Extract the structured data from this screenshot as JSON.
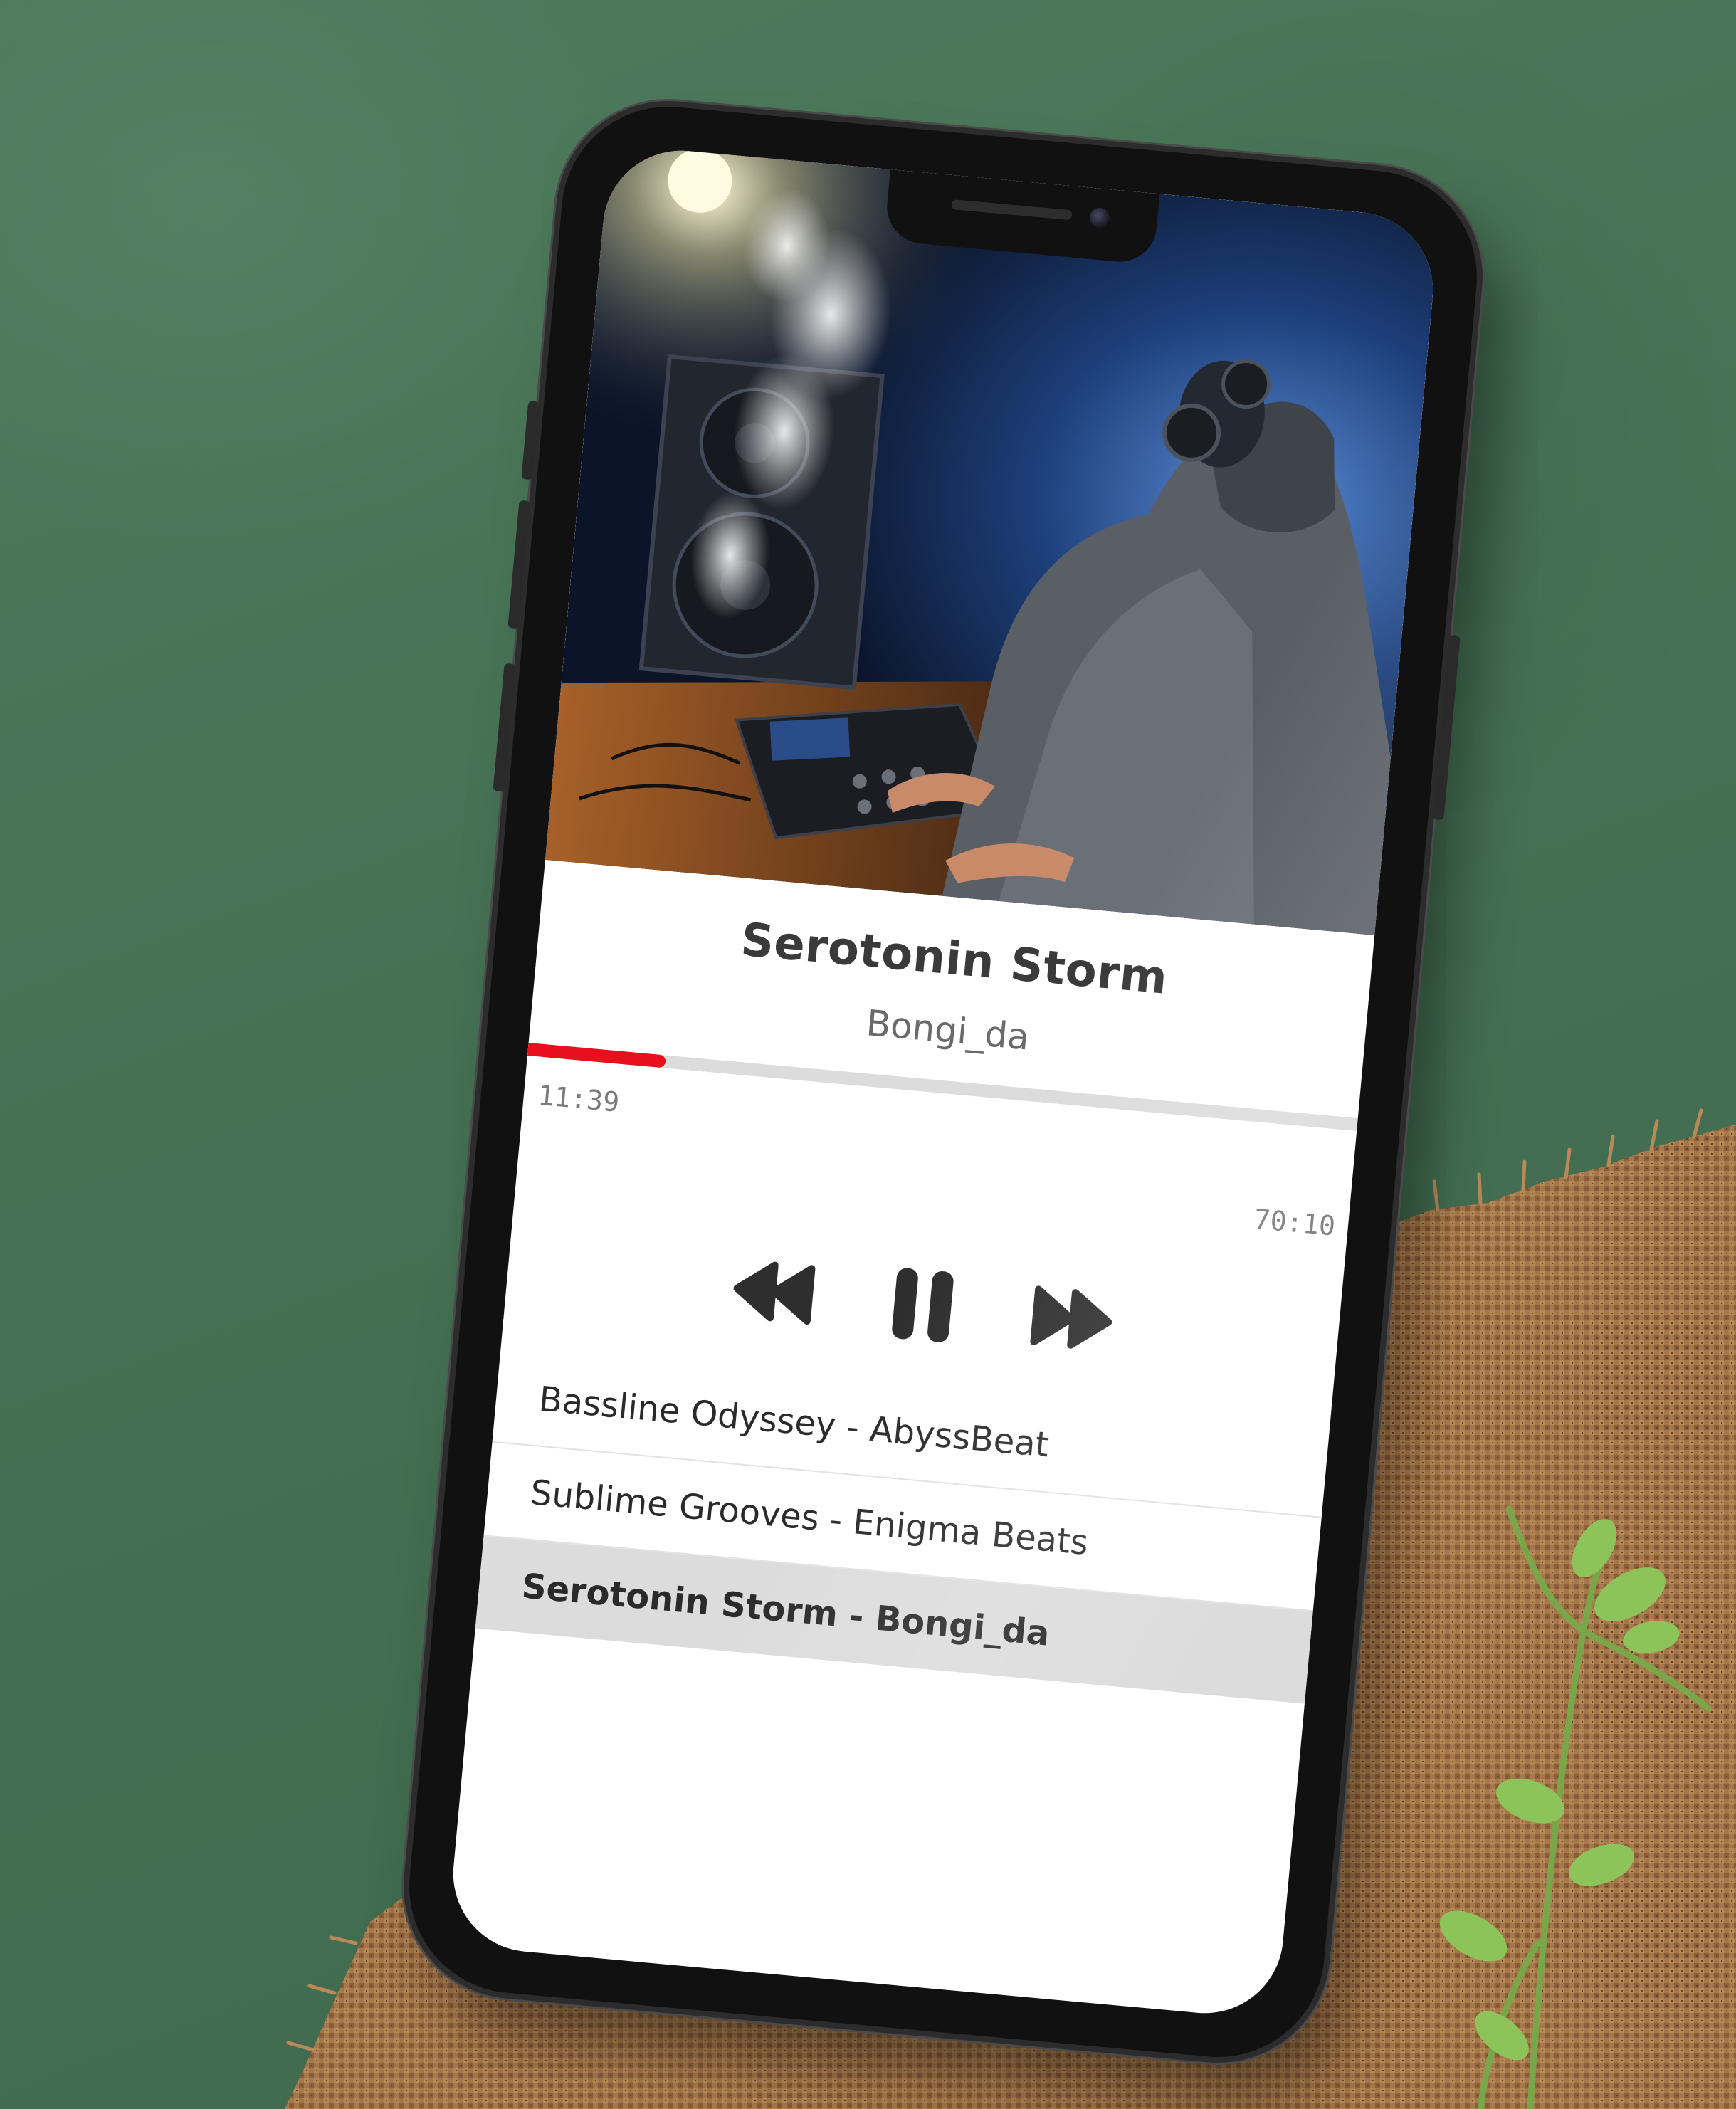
{
  "player": {
    "track_title": "Serotonin Storm",
    "track_artist": "Bongi_da",
    "time_elapsed": "11:39",
    "time_total": "70:10",
    "progress_fraction": 0.166
  },
  "controls": {
    "rewind_icon": "rewind-icon",
    "pause_icon": "pause-icon",
    "fast_forward_icon": "fast-forward-icon"
  },
  "playlist": {
    "items": [
      {
        "label": "Bassline Odyssey - AbyssBeat",
        "active": false
      },
      {
        "label": "Sublime Grooves - Enigma Beats",
        "active": false
      },
      {
        "label": "Serotonin Storm - Bongi_da",
        "active": true
      }
    ]
  },
  "colors": {
    "accent": "#e8101c",
    "progress_bg": "#dcdcdc",
    "active_row_bg": "#dcdcdc",
    "background_green": "#4a7657",
    "burlap": "#a8764a"
  }
}
